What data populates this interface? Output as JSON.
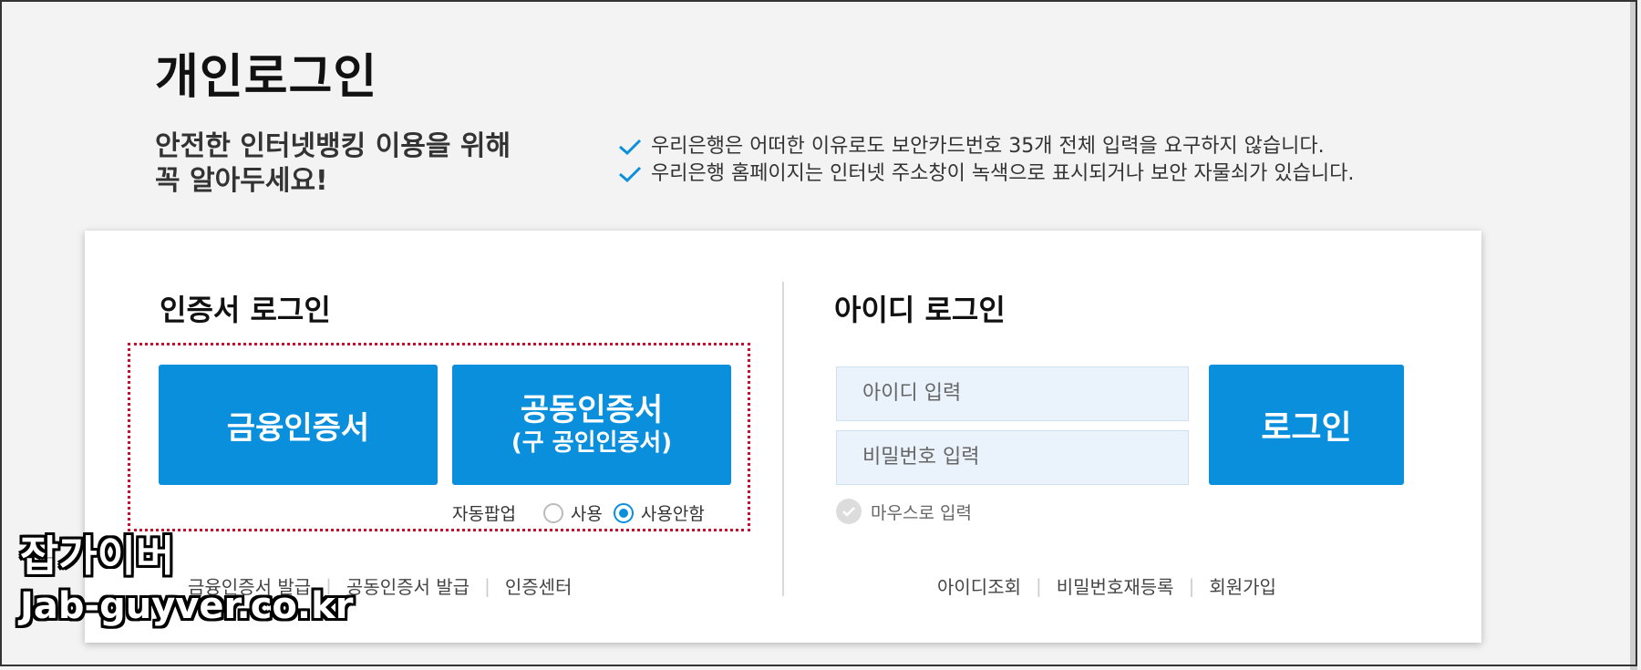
{
  "page": {
    "title": "개인로그인",
    "notice_heading_line1": "안전한 인터넷뱅킹 이용을 위해",
    "notice_heading_line2": "꼭 알아두세요!",
    "notices": [
      "우리은행은 어떠한 이유로도 보안카드번호 35개 전체 입력을 요구하지 않습니다.",
      "우리은행 홈페이지는 인터넷 주소창이 녹색으로 표시되거나 보안 자물쇠가 있습니다."
    ],
    "accent_color": "#0a8fdd"
  },
  "cert_login": {
    "title": "인증서 로그인",
    "financial_cert_button": "금융인증서",
    "joint_cert_button": "공동인증서",
    "joint_cert_sub": "(구 공인인증서)",
    "auto_popup_label": "자동팝업",
    "popup_options": [
      "사용",
      "사용안함"
    ],
    "popup_selected": "사용안함",
    "links": [
      "금융인증서 발급",
      "공동인증서 발급",
      "인증센터"
    ]
  },
  "id_login": {
    "title": "아이디 로그인",
    "id_placeholder": "아이디 입력",
    "pw_placeholder": "비밀번호 입력",
    "login_button": "로그인",
    "mouse_input_label": "마우스로 입력",
    "links": [
      "아이디조회",
      "비밀번호재등록",
      "회원가입"
    ]
  },
  "watermark": {
    "line1": "잡가이버",
    "line2": "Jab-guyver.co.kr"
  }
}
